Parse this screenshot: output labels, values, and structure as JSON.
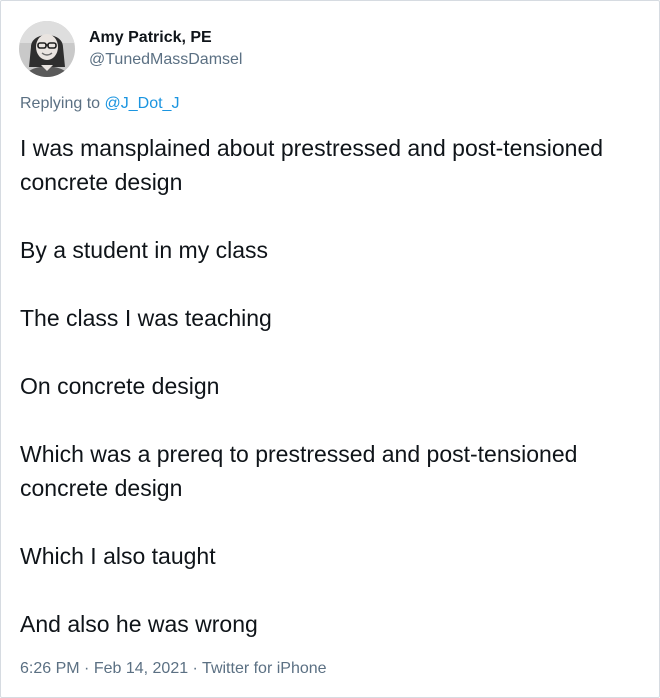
{
  "user": {
    "display_name": "Amy Patrick, PE",
    "handle": "@TunedMassDamsel"
  },
  "reply": {
    "prefix": "Replying to ",
    "mention": "@J_Dot_J"
  },
  "tweet": {
    "paragraphs": [
      "I was mansplained about prestressed and post-tensioned concrete design",
      "By a student in my class",
      "The class I was teaching",
      "On concrete design",
      "Which was a prereq to prestressed and post-tensioned concrete design",
      "Which I also taught",
      "And also he was wrong"
    ]
  },
  "meta": {
    "time": "6:26 PM",
    "separator": " · ",
    "date": "Feb 14, 2021",
    "source": "Twitter for iPhone"
  },
  "colors": {
    "text": "#0f1419",
    "secondary": "#5b7083",
    "link": "#1b95e0",
    "border": "#d6dbe1"
  },
  "icons": {
    "avatar": "profile-photo"
  }
}
